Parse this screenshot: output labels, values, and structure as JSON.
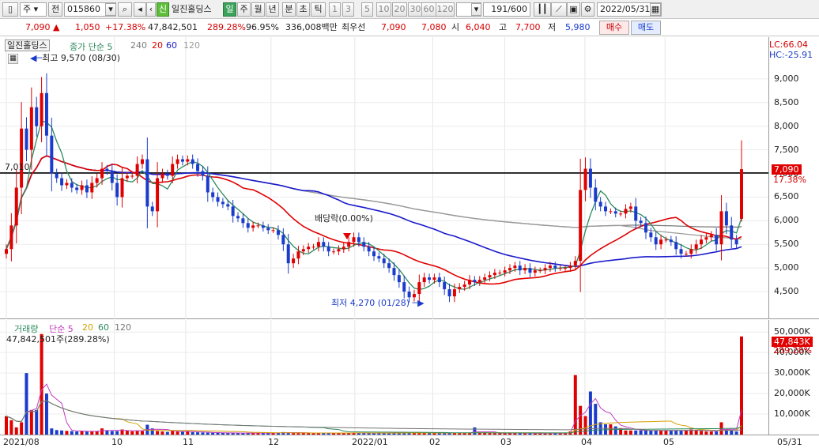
{
  "toolbar": {
    "market_tab": "주",
    "market_caret": "▾",
    "prev_label": "전",
    "code": "015860",
    "speaker": "◂",
    "credit_badge": "신",
    "stock_name": "일진홀딩스",
    "period_buttons": [
      "일",
      "주",
      "월",
      "년",
      "분",
      "초",
      "틱"
    ],
    "minute_buttons": [
      "1",
      "3",
      "5",
      "10",
      "20",
      "30",
      "60",
      "120"
    ],
    "count": "191",
    "total": "/600",
    "date": "2022/05/31"
  },
  "quote": {
    "price": "7,090",
    "arrow": "▲",
    "change": "1,050",
    "change_pct": "+17.38%",
    "volume": "47,842,501",
    "volume_pct": "289.28%",
    "ratio": "96.95%",
    "amount": "336,008백만",
    "best_label": "최우선",
    "ask": "7,090",
    "bid": "7,080",
    "open_label": "시",
    "open": "6,040",
    "high_label": "고",
    "high": "7,700",
    "low_label": "저",
    "low": "5,980",
    "buy_button": "매수",
    "sell_button": "매도"
  },
  "price_panel": {
    "name_label": "일진홀딩스",
    "legend": [
      "종가 단순 5",
      "240",
      "20",
      "60",
      "120"
    ],
    "lc": "LC:66.04",
    "hc": "HC:-25.91",
    "high_note": "최고 9,570 (08/30)",
    "low_note": "최저 4,270 (01/28)",
    "dividend_note": "배당락(0.00%)",
    "level_left": "7,010",
    "current_price_tag": "7,090",
    "current_pct_tag": "17.38%",
    "colors": {
      "up": "#e00000",
      "down": "#1a3ccc",
      "ma5": "#2c8a5e",
      "ma20": "#e00000",
      "ma60": "#1a1acc",
      "ma120": "#9a9a9a",
      "ma240": "#7a7a7a"
    }
  },
  "volume_panel": {
    "legend_title": "거래량",
    "legend_items": [
      "단순 5",
      "20",
      "60",
      "120"
    ],
    "value_note": "47,842,501주(289.28%)",
    "current_tag": "47,843K",
    "current_pct": "289.28%"
  },
  "x_axis": {
    "labels": [
      "2021/08",
      "10",
      "11",
      "12",
      "2022/01",
      "02",
      "03",
      "04",
      "05",
      "05/31"
    ]
  },
  "chart_data": {
    "type": "candlestick",
    "price_ticks": [
      4500,
      5000,
      5500,
      6000,
      6500,
      7000,
      7500,
      8000,
      8500,
      9000
    ],
    "price_range": [
      4000,
      9800
    ],
    "volume_ticks": [
      10000,
      20000,
      30000,
      40000,
      50000
    ],
    "volume_tick_labels": [
      "10,000K",
      "20,000K",
      "30,000K",
      "40,000K",
      "50,000K"
    ],
    "volume_range": [
      0,
      52000
    ],
    "last": {
      "date": "2022/05/31",
      "open": 6040,
      "high": 7700,
      "low": 5980,
      "close": 7090,
      "volume": 47842501
    },
    "high": {
      "price": 9570,
      "date": "08/30"
    },
    "low": {
      "price": 4270,
      "date": "01/28"
    },
    "closes": [
      5400,
      5900,
      6700,
      7950,
      7500,
      8400,
      8000,
      8700,
      7800,
      7000,
      6900,
      6750,
      6800,
      6700,
      6650,
      6750,
      6600,
      6800,
      6900,
      7100,
      7050,
      6800,
      6500,
      6900,
      6950,
      6950,
      7200,
      7300,
      6300,
      6200,
      6900,
      7000,
      6950,
      7200,
      7300,
      7250,
      7300,
      7200,
      7050,
      6950,
      6600,
      6500,
      6400,
      6350,
      6300,
      6100,
      6050,
      5950,
      5850,
      5900,
      5900,
      5850,
      5800,
      5800,
      5700,
      5500,
      5100,
      5200,
      5350,
      5400,
      5450,
      5450,
      5550,
      5450,
      5350,
      5350,
      5400,
      5450,
      5550,
      5650,
      5550,
      5450,
      5350,
      5250,
      5200,
      5100,
      5000,
      4850,
      4700,
      4500,
      4380,
      4450,
      4700,
      4800,
      4750,
      4800,
      4700,
      4550,
      4400,
      4550,
      4600,
      4650,
      4750,
      4700,
      4750,
      4800,
      4850,
      4900,
      4900,
      4950,
      5000,
      5050,
      4950,
      5000,
      4900,
      4950,
      4950,
      5000,
      5050,
      5000,
      5000,
      5000,
      5050,
      5150,
      6650,
      7100,
      6700,
      6400,
      6300,
      6200,
      6200,
      6150,
      6150,
      6250,
      6300,
      6000,
      5950,
      5750,
      5650,
      5500,
      5600,
      5600,
      5550,
      5400,
      5300,
      5300,
      5400,
      5500,
      5600,
      5650,
      5700,
      5500,
      6200,
      5900,
      5600,
      5500,
      7090
    ],
    "volumes": [
      9000,
      7000,
      3500,
      6000,
      30000,
      12000,
      12000,
      49000,
      20000,
      3000,
      2200,
      2000,
      1800,
      1700,
      1500,
      1600,
      1500,
      1700,
      1700,
      3000,
      2000,
      1700,
      1700,
      2500,
      1900,
      1600,
      1700,
      1700,
      4800,
      3000,
      1700,
      1500,
      1300,
      2000,
      1500,
      1300,
      1600,
      1200,
      1100,
      1000,
      900,
      900,
      800,
      800,
      800,
      700,
      700,
      700,
      700,
      700,
      700,
      700,
      700,
      800,
      1000,
      1200,
      1100,
      700,
      700,
      800,
      800,
      700,
      700,
      800,
      700,
      700,
      700,
      800,
      800,
      800,
      700,
      700,
      700,
      700,
      700,
      700,
      700,
      700,
      800,
      1200,
      1000,
      800,
      800,
      700,
      700,
      700,
      700,
      700,
      900,
      800,
      700,
      700,
      700,
      3500,
      800,
      800,
      700,
      600,
      700,
      600,
      900,
      700,
      600,
      600,
      700,
      600,
      600,
      600,
      700,
      600,
      700,
      800,
      1500,
      29000,
      14000,
      9000,
      21000,
      15000,
      6000,
      5000,
      5000,
      4000,
      3000,
      2000,
      2000,
      2000,
      2000,
      2000,
      2000,
      2000,
      2000,
      2000,
      2000,
      2000,
      2000,
      2000,
      2500,
      2000,
      1800,
      1500,
      1500,
      1500,
      6000,
      2000,
      2000,
      1500,
      47843
    ]
  }
}
